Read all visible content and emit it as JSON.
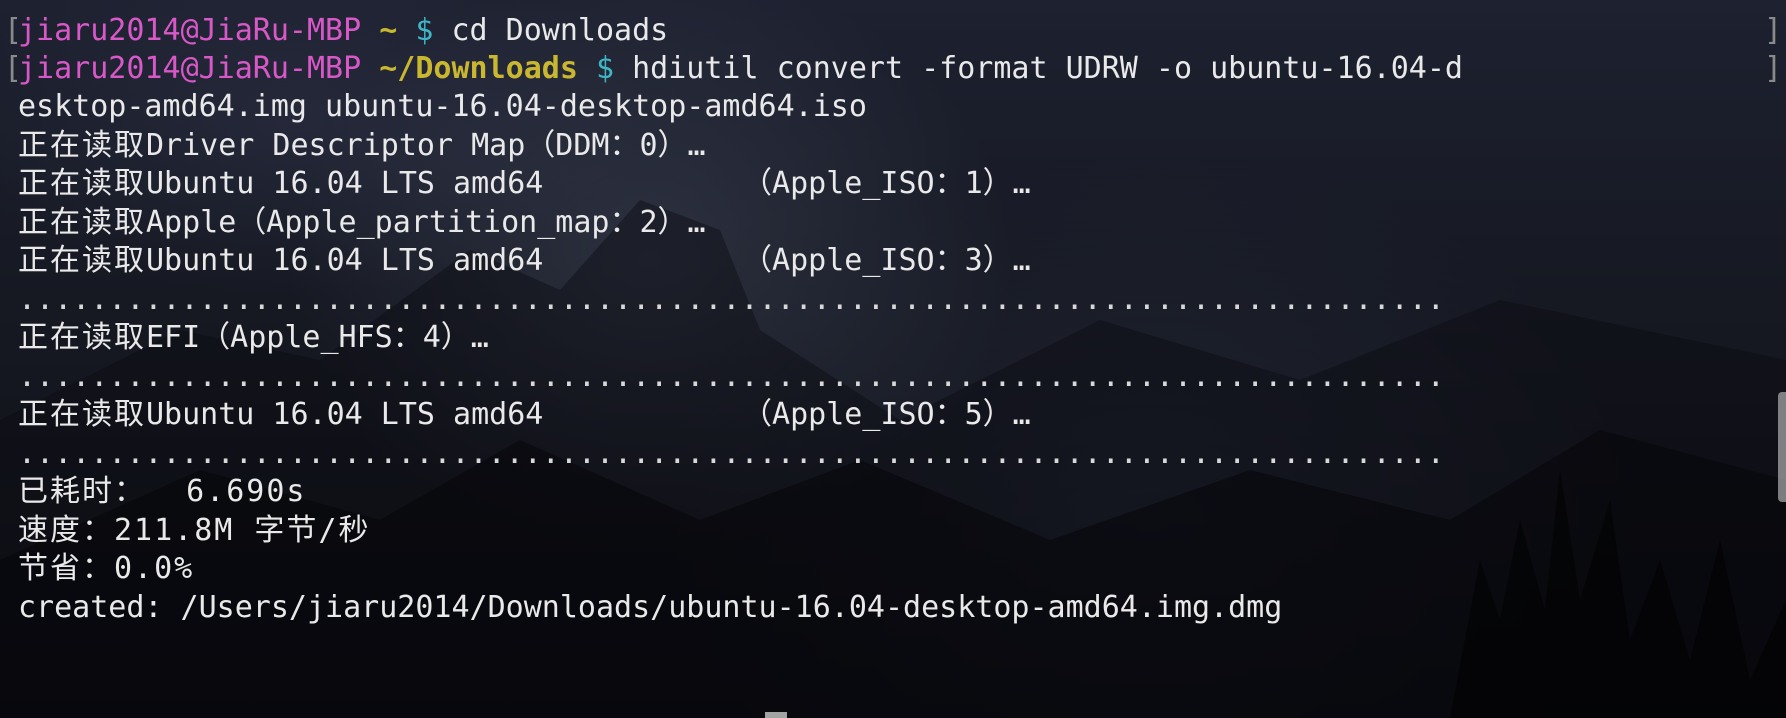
{
  "prompt1": {
    "user": "jiaru2014",
    "at": "@",
    "host": "JiaRu-MBP",
    "cwd": "~",
    "dollar": "$",
    "command": "cd Downloads"
  },
  "prompt2": {
    "user": "jiaru2014",
    "at": "@",
    "host": "JiaRu-MBP",
    "cwd": "~/Downloads",
    "dollar": "$",
    "command": "hdiutil convert -format UDRW -o ubuntu-16.04-d",
    "command_cont": "esktop-amd64.img ubuntu-16.04-desktop-amd64.iso"
  },
  "output": {
    "line1_zh": "正在读取",
    "line1": "Driver Descriptor Map（DDM：0）…",
    "line2_zh": "正在读取",
    "line2": "Ubuntu 16.04 LTS amd64           （Apple_ISO：1）…",
    "line3_zh": "正在读取",
    "line3": "Apple（Apple_partition_map：2）…",
    "line4_zh": "正在读取",
    "line4": "Ubuntu 16.04 LTS amd64           （Apple_ISO：3）…",
    "dots1": "...............................................................................",
    "line5_zh": "正在读取",
    "line5": "EFI（Apple_HFS：4）…",
    "dots2": "...............................................................................",
    "line6_zh": "正在读取",
    "line6": "Ubuntu 16.04 LTS amd64           （Apple_ISO：5）…",
    "dots3": "...............................................................................",
    "elapsed": "已耗时：  6.690s",
    "speed": "速度：211.8M 字节/秒",
    "savings": "节省：0.0%",
    "created": "created: /Users/jiaru2014/Downloads/ubuntu-16.04-desktop-amd64.img.dmg"
  },
  "colors": {
    "user_host": "#d958c8",
    "cwd": "#c9b82f",
    "dollar": "#3fb6c7",
    "text": "#e9e9e9"
  }
}
